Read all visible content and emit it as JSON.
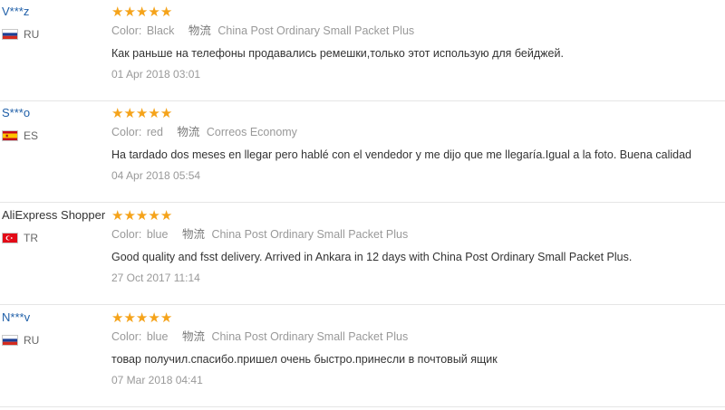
{
  "reviews": [
    {
      "user": "V***z",
      "masked": true,
      "country": "RU",
      "flag": "ru",
      "stars": 5,
      "color_label": "Color:",
      "color_value": "Black",
      "shipping_label": "物流",
      "shipping_value": "China Post Ordinary Small Packet Plus",
      "text": "Как раньше на телефоны продавались ремешки,только этот использую для бейджей.",
      "date": "01 Apr 2018 03:01"
    },
    {
      "user": "S***o",
      "masked": true,
      "country": "ES",
      "flag": "es",
      "stars": 5,
      "color_label": "Color:",
      "color_value": "red",
      "shipping_label": "物流",
      "shipping_value": "Correos Economy",
      "text": "Ha tardado dos meses en llegar pero hablé con el vendedor y me dijo que me llegaría.Igual a la foto. Buena calidad",
      "date": "04 Apr 2018 05:54"
    },
    {
      "user": "AliExpress Shopper",
      "masked": false,
      "country": "TR",
      "flag": "tr",
      "stars": 5,
      "color_label": "Color:",
      "color_value": "blue",
      "shipping_label": "物流",
      "shipping_value": "China Post Ordinary Small Packet Plus",
      "text": "Good quality and fsst delivery. Arrived in Ankara in 12 days with China Post Ordinary Small Packet Plus.",
      "date": "27 Oct 2017 11:14"
    },
    {
      "user": "N***v",
      "masked": true,
      "country": "RU",
      "flag": "ru",
      "stars": 5,
      "color_label": "Color:",
      "color_value": "blue",
      "shipping_label": "物流",
      "shipping_value": "China Post Ordinary Small Packet Plus",
      "text": "товар получил.спасибо.пришел очень быстро.принесли в почтовый ящик",
      "date": "07 Mar 2018 04:41"
    }
  ],
  "colors": {
    "star": "#f5a31a",
    "masked_user": "#1f5fa8",
    "text": "#333333",
    "muted": "#999999"
  }
}
